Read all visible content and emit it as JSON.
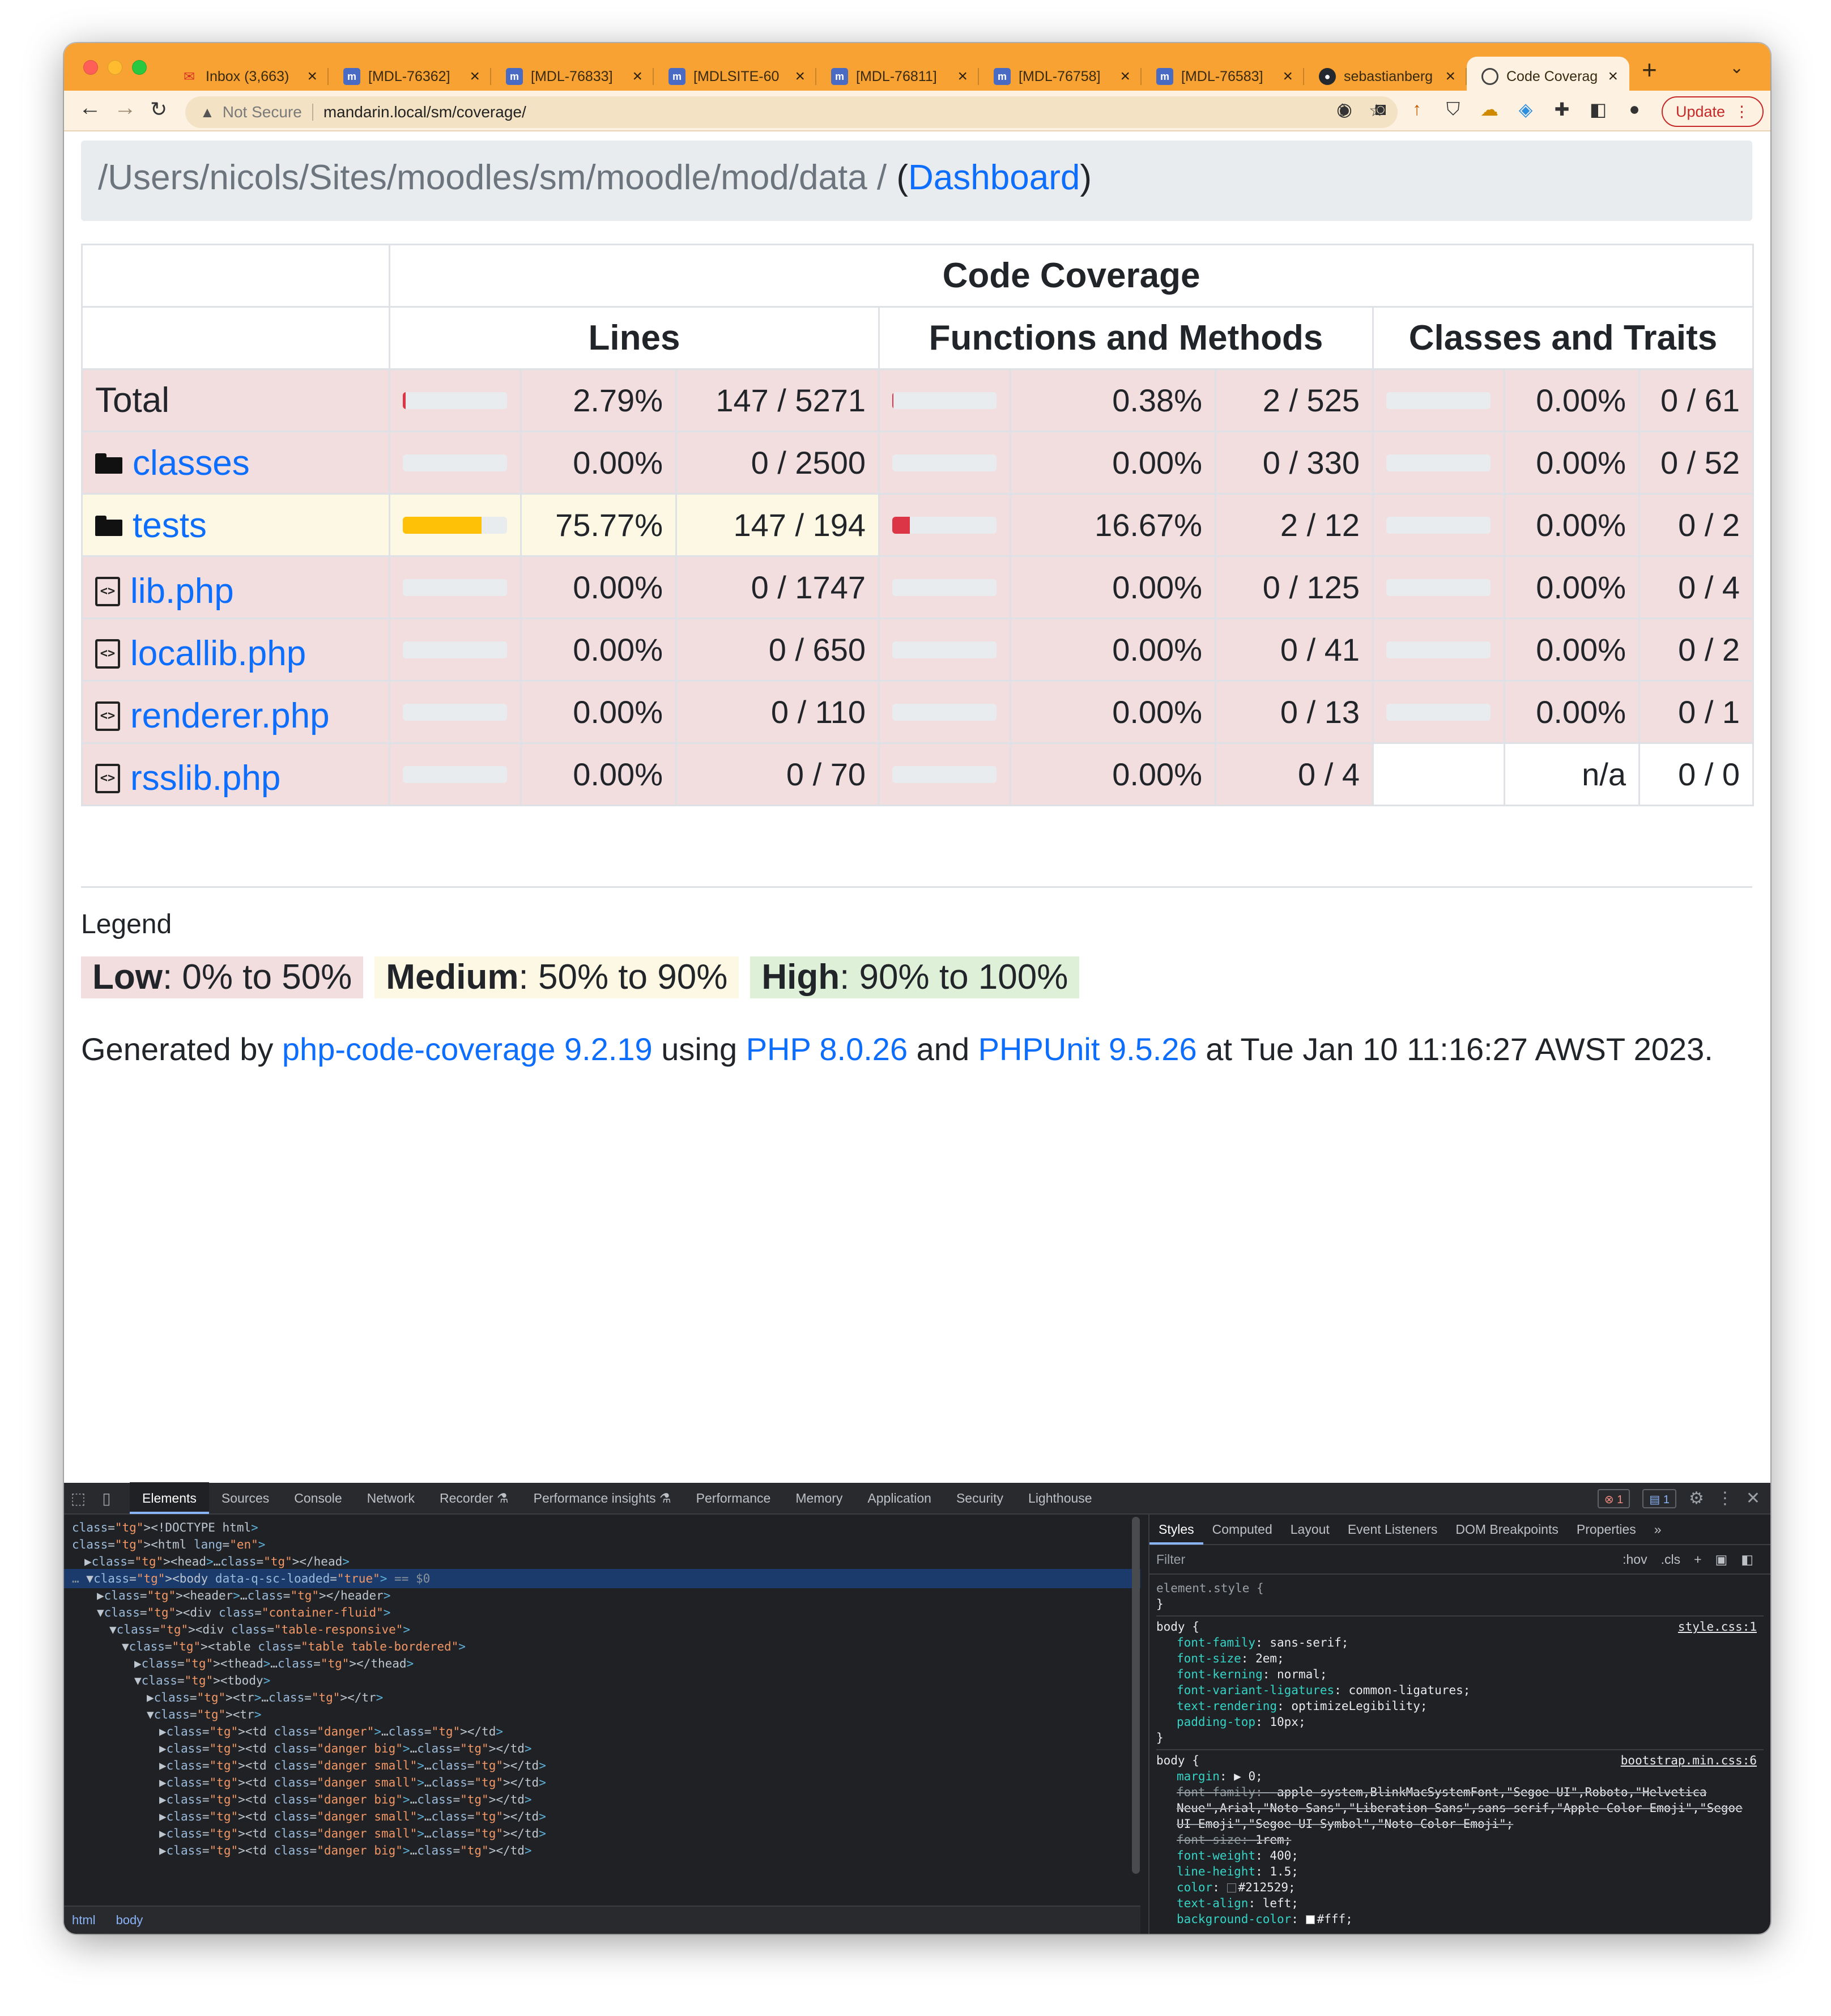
{
  "browser": {
    "tabs": [
      {
        "icon": "mail-icon",
        "title": "Inbox (3,663)"
      },
      {
        "icon": "moodle-tracker-icon",
        "title": "[MDL-76362]"
      },
      {
        "icon": "moodle-tracker-icon",
        "title": "[MDL-76833]"
      },
      {
        "icon": "moodle-tracker-icon",
        "title": "[MDLSITE-60"
      },
      {
        "icon": "moodle-tracker-icon",
        "title": "[MDL-76811]"
      },
      {
        "icon": "moodle-tracker-icon",
        "title": "[MDL-76758]"
      },
      {
        "icon": "moodle-tracker-icon",
        "title": "[MDL-76583]"
      },
      {
        "icon": "github-icon",
        "title": "sebastianberg"
      },
      {
        "icon": "globe-icon",
        "title": "Code Coverag"
      }
    ],
    "security_label": "Not Secure",
    "url": "mandarin.local/sm/coverage/",
    "update_label": "Update"
  },
  "page": {
    "breadcrumb_path": "/Users/nicols/Sites/moodles/sm/moodle/mod/data / ",
    "paren_open": "(",
    "dashboard_link": "Dashboard",
    "paren_close": ")",
    "table": {
      "group_header": "Code Coverage",
      "headers": {
        "lines": "Lines",
        "functions": "Functions and Methods",
        "classes": "Classes and Traits"
      },
      "rows": [
        {
          "name": "Total",
          "type": "total",
          "lines_pct": "2.79%",
          "lines": "147 / 5271",
          "lines_fill": 2.79,
          "lines_level": "danger",
          "funcs_pct": "0.38%",
          "funcs": "2 / 525",
          "funcs_fill": 0.38,
          "funcs_level": "danger",
          "classes_pct": "0.00%",
          "classes": "0 / 61",
          "classes_fill": 0,
          "classes_level": "danger"
        },
        {
          "name": "classes",
          "type": "folder",
          "lines_pct": "0.00%",
          "lines": "0 / 2500",
          "lines_fill": 0,
          "lines_level": "danger",
          "funcs_pct": "0.00%",
          "funcs": "0 / 330",
          "funcs_fill": 0,
          "funcs_level": "danger",
          "classes_pct": "0.00%",
          "classes": "0 / 52",
          "classes_fill": 0,
          "classes_level": "danger"
        },
        {
          "name": "tests",
          "type": "folder",
          "lines_pct": "75.77%",
          "lines": "147 / 194",
          "lines_fill": 75.77,
          "lines_level": "warning",
          "funcs_pct": "16.67%",
          "funcs": "2 / 12",
          "funcs_fill": 16.67,
          "funcs_level": "danger",
          "classes_pct": "0.00%",
          "classes": "0 / 2",
          "classes_fill": 0,
          "classes_level": "danger"
        },
        {
          "name": "lib.php",
          "type": "file",
          "lines_pct": "0.00%",
          "lines": "0 / 1747",
          "lines_fill": 0,
          "lines_level": "danger",
          "funcs_pct": "0.00%",
          "funcs": "0 / 125",
          "funcs_fill": 0,
          "funcs_level": "danger",
          "classes_pct": "0.00%",
          "classes": "0 / 4",
          "classes_fill": 0,
          "classes_level": "danger"
        },
        {
          "name": "locallib.php",
          "type": "file",
          "lines_pct": "0.00%",
          "lines": "0 / 650",
          "lines_fill": 0,
          "lines_level": "danger",
          "funcs_pct": "0.00%",
          "funcs": "0 / 41",
          "funcs_fill": 0,
          "funcs_level": "danger",
          "classes_pct": "0.00%",
          "classes": "0 / 2",
          "classes_fill": 0,
          "classes_level": "danger"
        },
        {
          "name": "renderer.php",
          "type": "file",
          "lines_pct": "0.00%",
          "lines": "0 / 110",
          "lines_fill": 0,
          "lines_level": "danger",
          "funcs_pct": "0.00%",
          "funcs": "0 / 13",
          "funcs_fill": 0,
          "funcs_level": "danger",
          "classes_pct": "0.00%",
          "classes": "0 / 1",
          "classes_fill": 0,
          "classes_level": "danger"
        },
        {
          "name": "rsslib.php",
          "type": "file",
          "lines_pct": "0.00%",
          "lines": "0 / 70",
          "lines_fill": 0,
          "lines_level": "danger",
          "funcs_pct": "0.00%",
          "funcs": "0 / 4",
          "funcs_fill": 0,
          "funcs_level": "danger",
          "classes_pct": "n/a",
          "classes": "0 / 0",
          "classes_fill": null,
          "classes_level": "none"
        }
      ]
    },
    "legend": {
      "title": "Legend",
      "low_label": "Low",
      "low_range": ": 0% to 50%",
      "medium_label": "Medium",
      "medium_range": ": 50% to 90%",
      "high_label": "High",
      "high_range": ": 90% to 100%"
    },
    "footer": {
      "prefix": "Generated by ",
      "tool_link": "php-code-coverage 9.2.19",
      "using": " using ",
      "php_link": "PHP 8.0.26",
      "and": " and ",
      "phpunit_link": "PHPUnit 9.5.26",
      "suffix": " at Tue Jan 10 11:16:27 AWST 2023."
    }
  },
  "devtools": {
    "tabs": [
      "Elements",
      "Sources",
      "Console",
      "Network",
      "Recorder ⚗",
      "Performance insights ⚗",
      "Performance",
      "Memory",
      "Application",
      "Security",
      "Lighthouse"
    ],
    "error_count": "1",
    "message_count": "1",
    "dom_lines": [
      "<!DOCTYPE html>",
      "<html lang=\"en\">",
      "▶<head>…</head>",
      "▼<body data-q-sc-loaded=\"true\"> == $0",
      "▶<header>…</header>",
      "▼<div class=\"container-fluid\">",
      "▼<div class=\"table-responsive\">",
      "▼<table class=\"table table-bordered\">",
      "▶<thead>…</thead>",
      "▼<tbody>",
      "▶<tr>…</tr>",
      "▼<tr>",
      "▶<td class=\"danger\">…</td>",
      "▶<td class=\"danger big\">…</td>",
      "▶<td class=\"danger small\">…</td>",
      "▶<td class=\"danger small\">…</td>",
      "▶<td class=\"danger big\">…</td>",
      "▶<td class=\"danger small\">…</td>",
      "▶<td class=\"danger small\">…</td>",
      "▶<td class=\"danger big\">…</td>"
    ],
    "breadcrumbs": [
      "html",
      "body"
    ],
    "styles_tabs": [
      "Styles",
      "Computed",
      "Layout",
      "Event Listeners",
      "DOM Breakpoints",
      "Properties",
      "»"
    ],
    "filter_placeholder": "Filter",
    "filter_hov": ":hov",
    "filter_cls": ".cls",
    "element_style": "element.style {",
    "rule1_selector": "body {",
    "rule1_source": "style.css:1",
    "rule1_props": [
      [
        "font-family",
        "sans-serif;"
      ],
      [
        "font-size",
        "2em;"
      ],
      [
        "font-kerning",
        "normal;"
      ],
      [
        "font-variant-ligatures",
        "common-ligatures;"
      ],
      [
        "text-rendering",
        "optimizeLegibility;"
      ],
      [
        "padding-top",
        "10px;"
      ]
    ],
    "rule2_selector": "body {",
    "rule2_source": "bootstrap.min.css:6",
    "rule2_props": [
      [
        "margin",
        "▶ 0;",
        false
      ],
      [
        "font-family",
        "-apple-system,BlinkMacSystemFont,\"Segoe UI\",Roboto,\"Helvetica Neue\",Arial,\"Noto Sans\",\"Liberation Sans\",sans-serif,\"Apple Color Emoji\",\"Segoe UI Emoji\",\"Segoe UI Symbol\",\"Noto Color Emoji\";",
        true
      ],
      [
        "font-size",
        "1rem;",
        true
      ],
      [
        "font-weight",
        "400;",
        false
      ],
      [
        "line-height",
        "1.5;",
        false
      ],
      [
        "color",
        "#212529;",
        false
      ],
      [
        "text-align",
        "left;",
        false
      ],
      [
        "background-color",
        "#fff;",
        false
      ]
    ],
    "close_brace": "}"
  },
  "colors": {
    "tab_strip": "#f7a232",
    "low": "#f2dede",
    "medium": "#fcf8e3",
    "high": "#dff0d8",
    "bar_danger": "#dc3545",
    "bar_warning": "#ffc107",
    "link": "#0d6efd"
  }
}
